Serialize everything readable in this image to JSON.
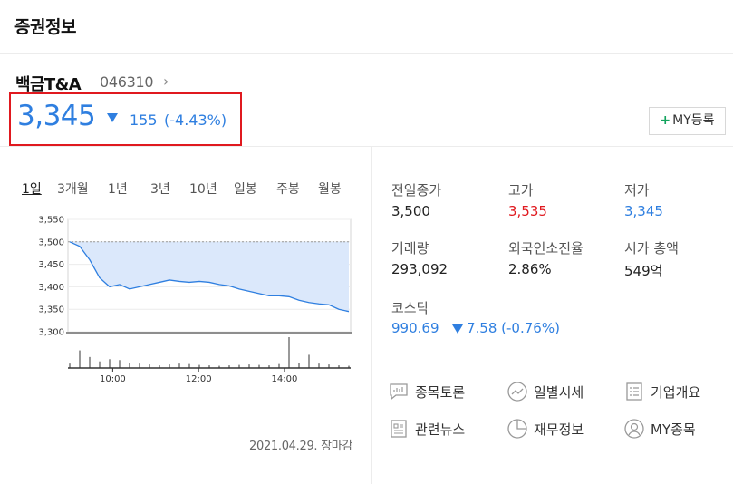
{
  "header": {
    "title": "증권정보"
  },
  "stock": {
    "name": "백금T&A",
    "code": "046310",
    "price": "3,345",
    "change": "155",
    "change_pct": "(-4.43%)",
    "my_register": "MY등록"
  },
  "periods": [
    "1일",
    "3개월",
    "1년",
    "3년",
    "10년",
    "일봉",
    "주봉",
    "월봉"
  ],
  "stats": {
    "prev_close": {
      "label": "전일종가",
      "value": "3,500"
    },
    "high": {
      "label": "고가",
      "value": "3,535"
    },
    "low": {
      "label": "저가",
      "value": "3,345"
    },
    "volume": {
      "label": "거래량",
      "value": "293,092"
    },
    "foreign_rate": {
      "label": "외국인소진율",
      "value": "2.86%"
    },
    "market_cap": {
      "label": "시가 총액",
      "value": "549억"
    }
  },
  "index": {
    "label": "코스닥",
    "value": "990.69",
    "change": "7.58 (-0.76%)"
  },
  "links": [
    {
      "label": "종목토론",
      "icon": "speech-bubble-icon"
    },
    {
      "label": "일별시세",
      "icon": "trend-circle-icon"
    },
    {
      "label": "기업개요",
      "icon": "list-doc-icon"
    },
    {
      "label": "관련뉴스",
      "icon": "news-doc-icon"
    },
    {
      "label": "재무정보",
      "icon": "pie-chart-icon"
    },
    {
      "label": "MY종목",
      "icon": "user-circle-icon"
    }
  ],
  "chart_data": {
    "type": "area",
    "ylabels": [
      "3,550",
      "3,500",
      "3,450",
      "3,400",
      "3,350",
      "3,300"
    ],
    "xlabels": [
      "10:00",
      "12:00",
      "14:00"
    ],
    "ylim": [
      3300,
      3550
    ],
    "reference_value": 3500,
    "x": [
      "09:00",
      "09:10",
      "09:20",
      "09:30",
      "09:40",
      "09:50",
      "10:00",
      "10:15",
      "10:30",
      "10:45",
      "11:00",
      "11:15",
      "11:30",
      "11:45",
      "12:00",
      "12:15",
      "12:30",
      "12:45",
      "13:00",
      "13:15",
      "13:30",
      "13:45",
      "14:00",
      "14:15",
      "14:30",
      "14:45",
      "15:00",
      "15:15",
      "15:30"
    ],
    "values": [
      3500,
      3490,
      3460,
      3420,
      3400,
      3405,
      3395,
      3400,
      3405,
      3410,
      3415,
      3412,
      3410,
      3412,
      3410,
      3405,
      3402,
      3395,
      3390,
      3385,
      3380,
      3380,
      3378,
      3370,
      3365,
      3362,
      3360,
      3350,
      3345
    ],
    "volume": [
      10,
      40,
      25,
      15,
      20,
      18,
      12,
      10,
      8,
      6,
      8,
      10,
      9,
      7,
      6,
      5,
      6,
      7,
      8,
      7,
      6,
      9,
      70,
      12,
      30,
      10,
      8,
      6,
      5
    ],
    "date_label": "2021.04.29. 장마감"
  }
}
